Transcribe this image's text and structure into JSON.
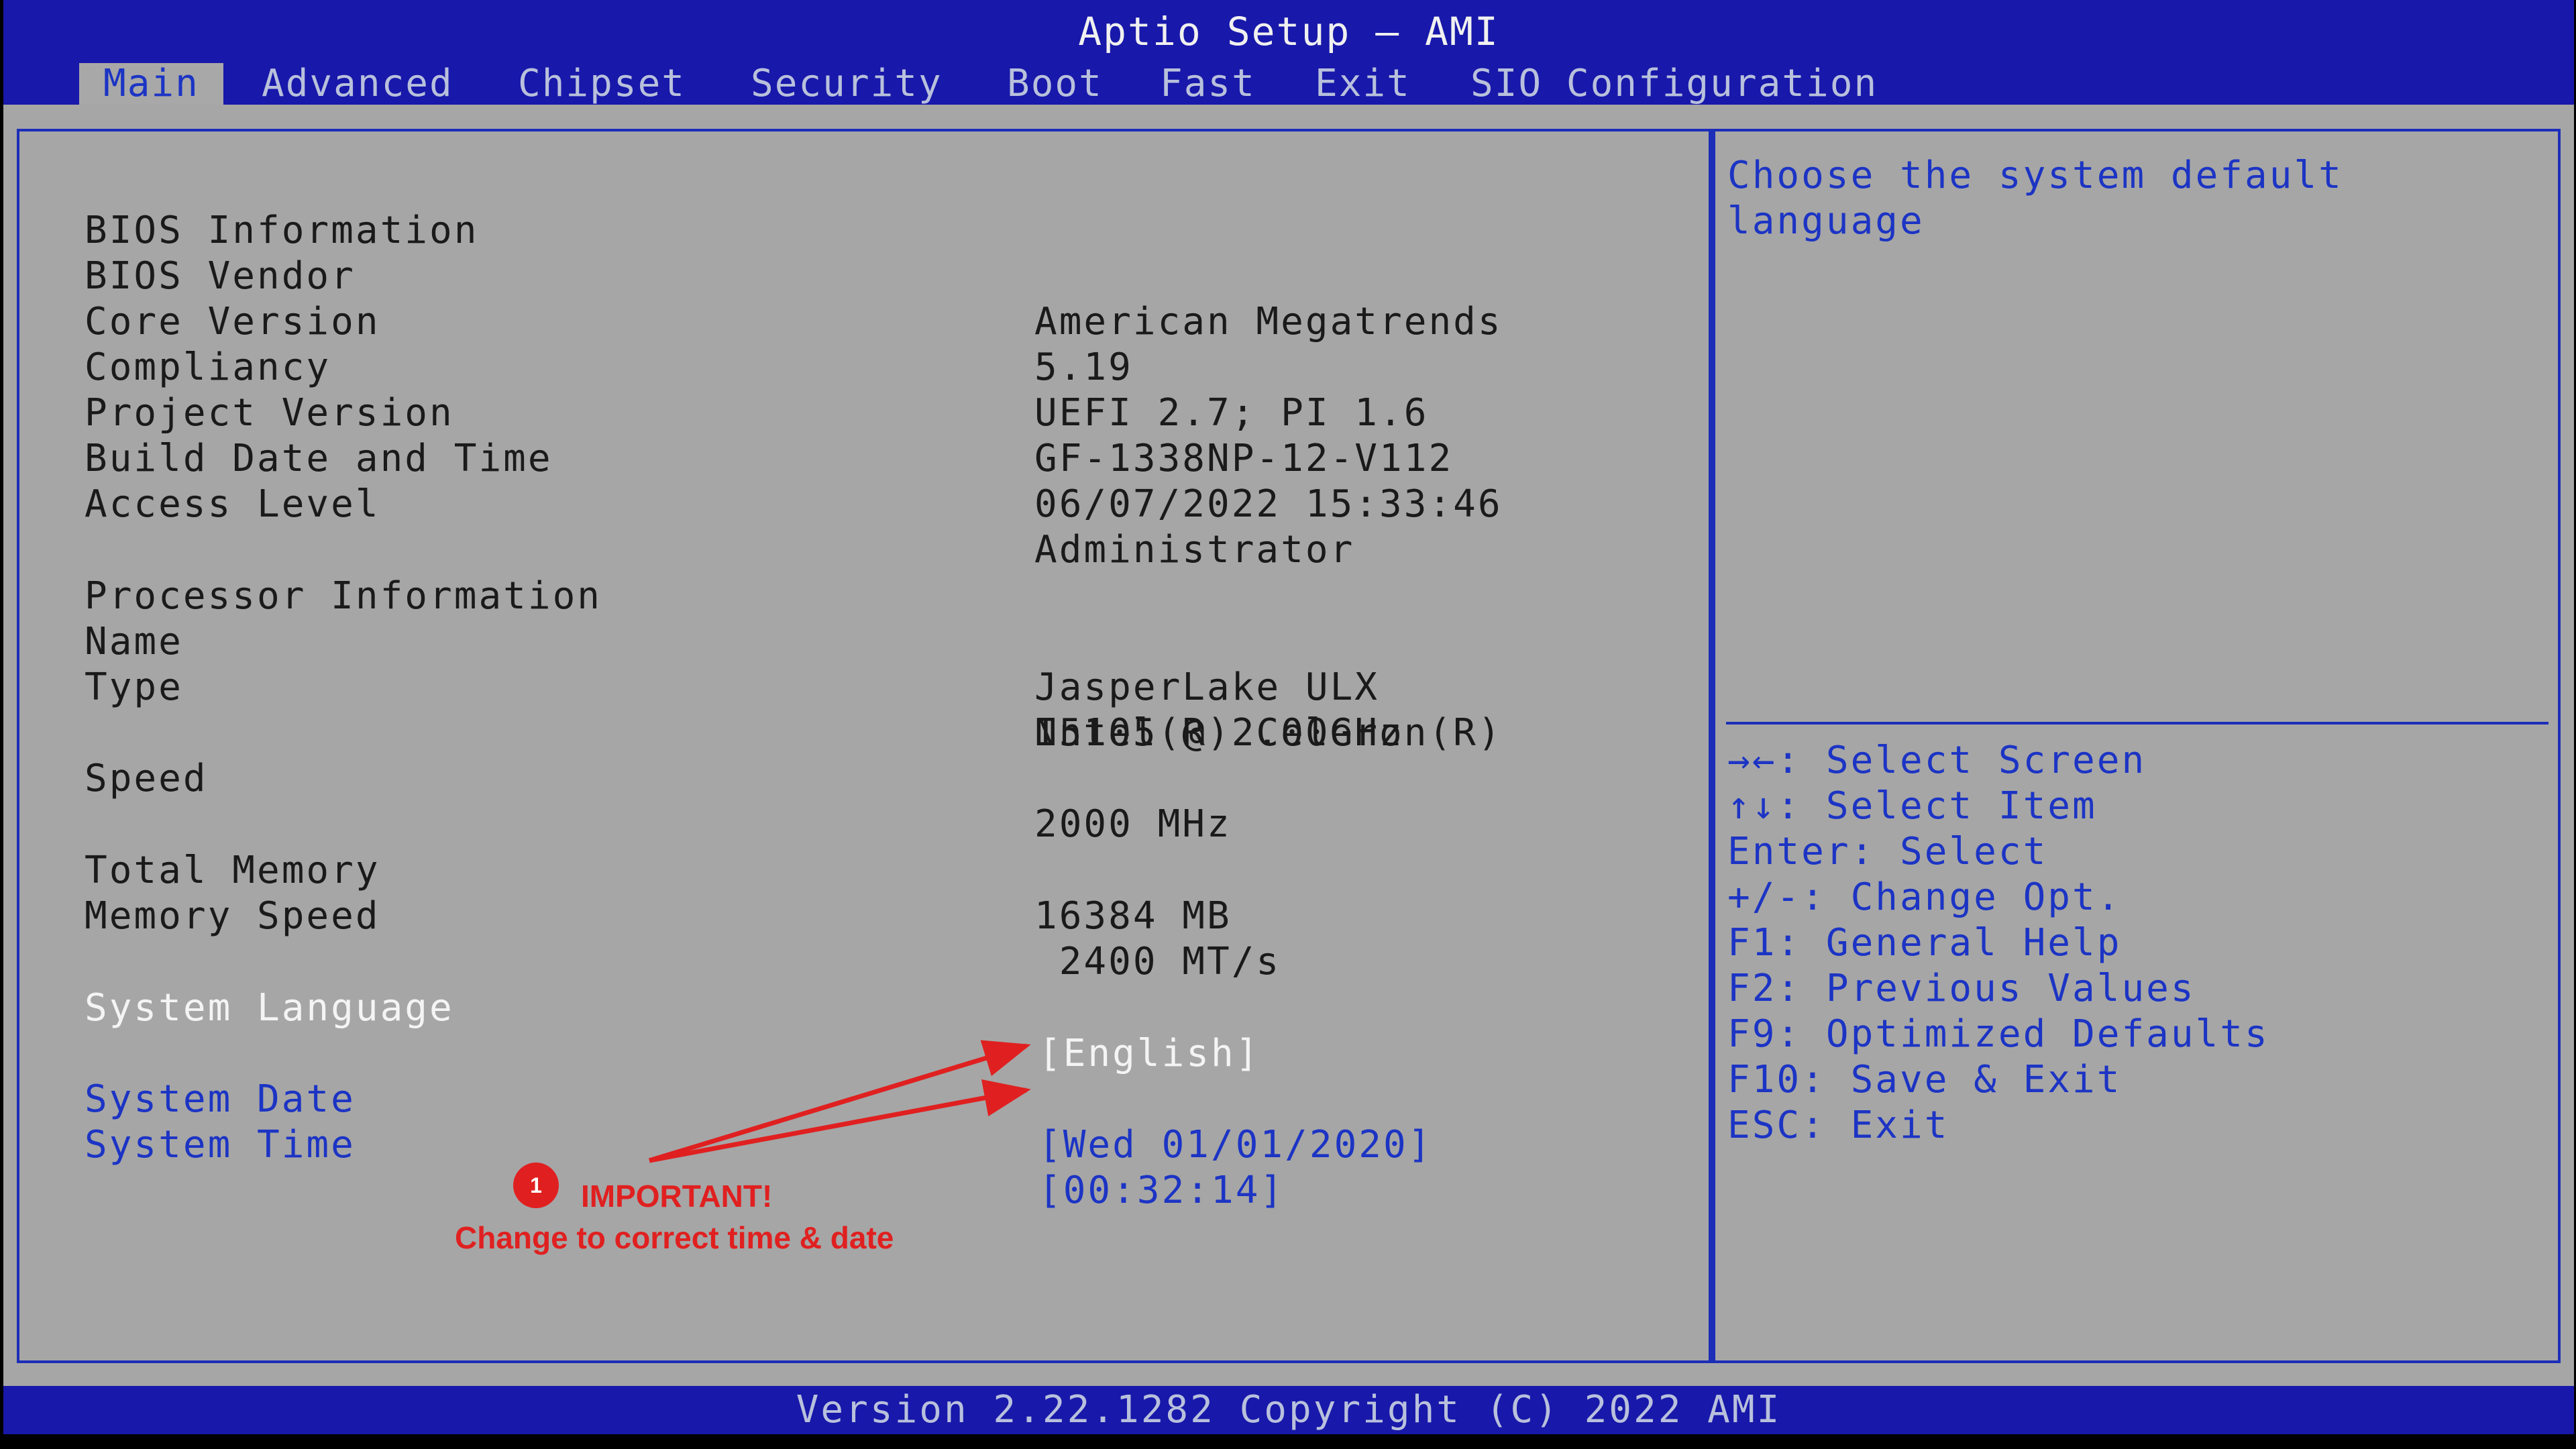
{
  "window": {
    "title": "Aptio Setup – AMI"
  },
  "tabs": [
    {
      "label": "Main",
      "active": true
    },
    {
      "label": "Advanced",
      "active": false
    },
    {
      "label": "Chipset",
      "active": false
    },
    {
      "label": "Security",
      "active": false
    },
    {
      "label": "Boot",
      "active": false
    },
    {
      "label": "Fast",
      "active": false
    },
    {
      "label": "Exit",
      "active": false
    },
    {
      "label": "SIO Configuration",
      "active": false
    }
  ],
  "main": {
    "rows": [
      {
        "label": "BIOS Information",
        "value": ""
      },
      {
        "label": "BIOS Vendor",
        "value": "American Megatrends"
      },
      {
        "label": "Core Version",
        "value": "5.19"
      },
      {
        "label": "Compliancy",
        "value": "UEFI 2.7; PI 1.6"
      },
      {
        "label": "Project Version",
        "value": "GF-1338NP-12-V112"
      },
      {
        "label": "Build Date and Time",
        "value": "06/07/2022 15:33:46"
      },
      {
        "label": "Access Level",
        "value": "Administrator"
      },
      {
        "label": "Processor Information",
        "value": ""
      },
      {
        "label": "Name",
        "value": "JasperLake ULX"
      },
      {
        "label": "Type",
        "value": "Intel(R) Celeron(R)"
      },
      {
        "label": "",
        "value": "N5105 @ 2.00GHz"
      },
      {
        "label": "Speed",
        "value": "2000 MHz"
      },
      {
        "label": "Total Memory",
        "value": "16384 MB"
      },
      {
        "label": "Memory Speed",
        "value": " 2400 MT/s"
      },
      {
        "label": "System Language",
        "value": "[English]"
      },
      {
        "label": "System Date",
        "value": "[Wed 01/01/2020]"
      },
      {
        "label": "System Time",
        "value": "[00:32:14]"
      }
    ]
  },
  "help": {
    "description": "Choose the system default\nlanguage",
    "keys": [
      "→←: Select Screen",
      "↑↓: Select Item",
      "Enter: Select",
      "+/-: Change Opt.",
      "F1: General Help",
      "F2: Previous Values",
      "F9: Optimized Defaults",
      "F10: Save & Exit",
      "ESC: Exit"
    ]
  },
  "footer": {
    "version": "Version 2.22.1282 Copyright (C) 2022 AMI"
  },
  "annotation": {
    "badge": "1",
    "title": "IMPORTANT!",
    "subtitle": "Change to correct  time & date"
  },
  "colors": {
    "bar_blue": "#1818aa",
    "panel_gray": "#a6a6a6",
    "highlight_blue": "#1c34c4",
    "annotation_red": "#e02020"
  }
}
